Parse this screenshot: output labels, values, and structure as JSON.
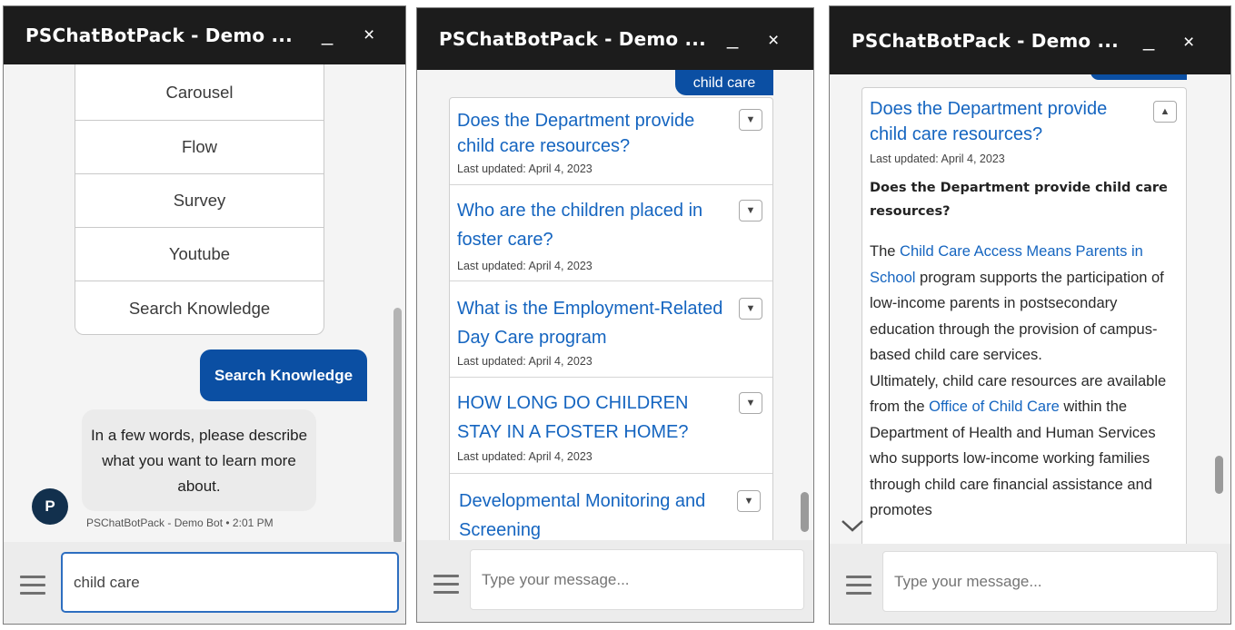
{
  "window_title": "PSChatBotPack - Demo ...",
  "minimize_glyph": "_",
  "close_glyph": "×",
  "panel1": {
    "menu_items": [
      "Carousel",
      "Flow",
      "Survey",
      "Youtube",
      "Search Knowledge"
    ],
    "user_message": "Search Knowledge",
    "bot_message": "In a few words, please describe what you want to learn more about.",
    "avatar_letter": "P",
    "bot_meta": "PSChatBotPack - Demo Bot • 2:01 PM",
    "input_value": "child care"
  },
  "panel2": {
    "user_message": "child care",
    "articles": [
      {
        "title": "Does the Department provide child care resources?",
        "date": "Last updated: April 4, 2023"
      },
      {
        "title": "Who are the children placed in foster care?",
        "date": "Last updated: April 4, 2023"
      },
      {
        "title": "What is the Employment-Related Day Care program",
        "date": "Last updated: April 4, 2023"
      },
      {
        "title": "HOW LONG DO CHILDREN STAY IN A FOSTER HOME?",
        "date": "Last updated: April 4, 2023"
      },
      {
        "title": "Developmental Monitoring and Screening",
        "date": ""
      }
    ],
    "input_placeholder": "Type your message..."
  },
  "panel3": {
    "article_title": "Does the Department provide child care resources?",
    "article_date": "Last updated: April 4, 2023",
    "article_heading": "Does the Department provide child care resources?",
    "para1_prefix": "The ",
    "para1_link": "Child Care Access Means Parents in School",
    "para1_rest": " program supports the participation of low-income parents in postsecondary education through the provision of campus-based child care services.",
    "para2_prefix": "Ultimately, child care resources are available from the ",
    "para2_link": "Office of Child Care",
    "para2_rest": " within the Department of Health and Human Services who supports low-income working families through child care financial assistance and promotes",
    "input_placeholder": "Type your message..."
  },
  "icons": {
    "hamburger": "menu-icon",
    "expand": "chevron-down-icon",
    "collapse": "chevron-up-icon",
    "scroll_down": "scroll-down-chevron-icon"
  },
  "colors": {
    "header": "#1c1c1c",
    "user_bubble": "#0b4fa3",
    "link": "#1565c0",
    "avatar": "#12304d"
  }
}
